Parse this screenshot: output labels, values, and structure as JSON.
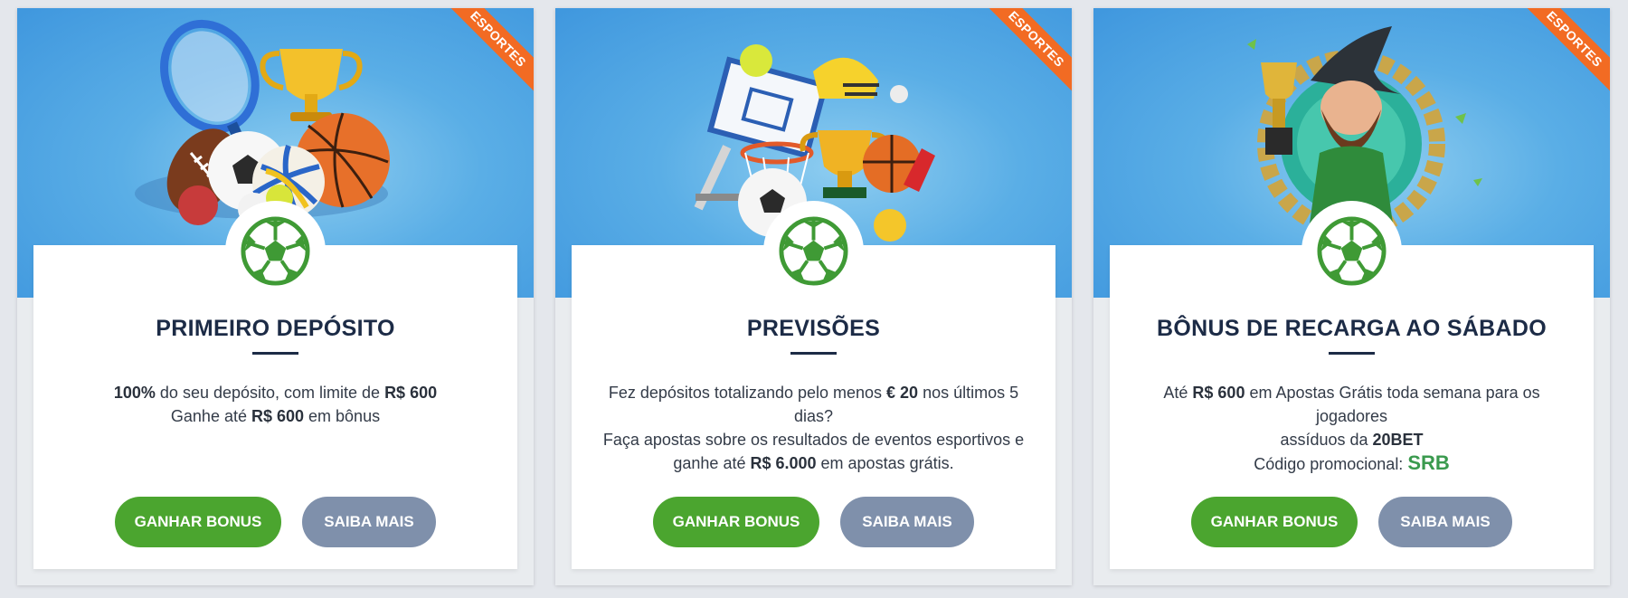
{
  "cards": [
    {
      "ribbon": "ESPORTES",
      "title": "PRIMEIRO DEPÓSITO",
      "desc": {
        "l1_b1": "100%",
        "l1_t1": " do seu depósito, com limite de ",
        "l1_b2": "R$ 600",
        "l2_t1": "Ganhe até ",
        "l2_b1": "R$ 600",
        "l2_t2": " em bônus"
      },
      "primary_button": "GANHAR BONUS",
      "secondary_button": "SAIBA MAIS",
      "badge_icon": "soccer-ball-icon",
      "illustration": "sports-balls-trophy-racket"
    },
    {
      "ribbon": "ESPORTES",
      "title": "PREVISÕES",
      "desc": {
        "l1_t1": "Fez depósitos totalizando pelo menos ",
        "l1_b1": "€ 20",
        "l1_t2": " nos últimos 5 dias?",
        "l2_t1": "Faça apostas sobre os resultados de eventos esportivos e",
        "l3_t1": "ganhe até ",
        "l3_b1": "R$ 6.000",
        "l3_t2": " em apostas grátis."
      },
      "primary_button": "GANHAR BONUS",
      "secondary_button": "SAIBA MAIS",
      "badge_icon": "soccer-ball-icon",
      "illustration": "basketball-hoop-trophy-balls"
    },
    {
      "ribbon": "ESPORTES",
      "title": "BÔNUS DE RECARGA AO SÁBADO",
      "desc": {
        "l1_t1": "Até ",
        "l1_b1": "R$ 600",
        "l1_t2": " em Apostas Grátis toda semana para os jogadores",
        "l2_t1": "assíduos da ",
        "l2_b1": "20BET",
        "l3_t1": "Código promocional: ",
        "promo_code": "SRB"
      },
      "primary_button": "GANHAR BONUS",
      "secondary_button": "SAIBA MAIS",
      "badge_icon": "soccer-ball-icon",
      "illustration": "wizard-mascot-trophy-wreath"
    }
  ],
  "colors": {
    "ribbon": "#f26b23",
    "primary_button": "#4ba52f",
    "secondary_button": "#7f90ab",
    "title": "#1c2b46",
    "promo": "#3a9a4e",
    "hero_sky": "#4ea3e2"
  }
}
